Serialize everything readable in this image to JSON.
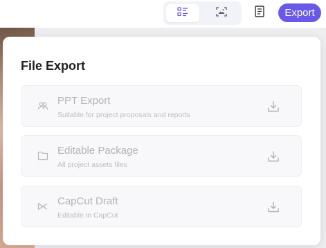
{
  "toolbar": {
    "view_toggle": [
      {
        "icon": "list-icon",
        "active": true
      },
      {
        "icon": "image-frame-icon",
        "active": false
      }
    ],
    "doc_icon": "document-icon",
    "export_label": "Export",
    "accent_color": "#6a59e8"
  },
  "panel": {
    "title": "File Export",
    "options": [
      {
        "icon": "users-icon",
        "title": "PPT Export",
        "subtitle": "Suitable for project proposals and reports",
        "action_icon": "download-icon"
      },
      {
        "icon": "folder-icon",
        "title": "Editable Package",
        "subtitle": "All project assets files",
        "action_icon": "download-icon"
      },
      {
        "icon": "capcut-icon",
        "title": "CapCut Draft",
        "subtitle": "Editable in CapCut",
        "action_icon": "download-icon"
      }
    ]
  }
}
